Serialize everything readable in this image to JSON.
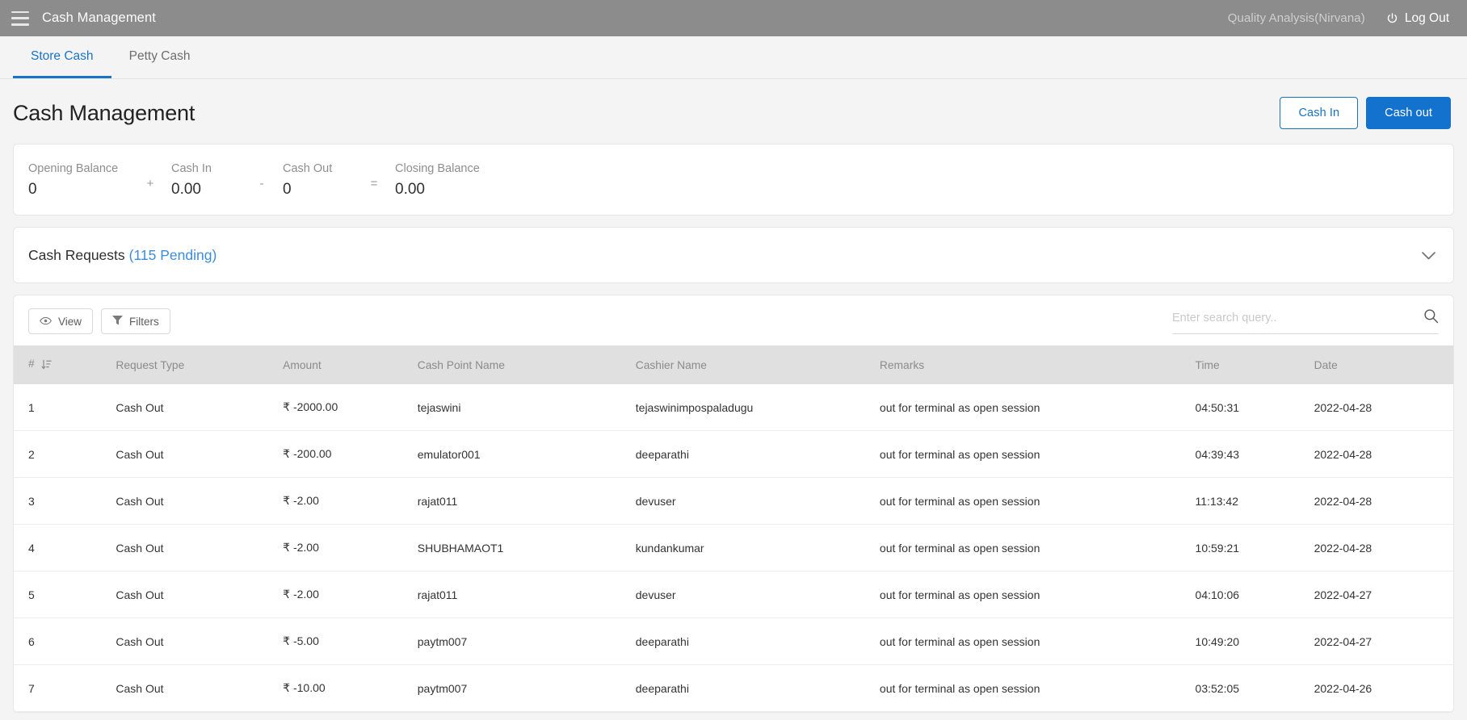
{
  "appbar": {
    "menu_icon": "hamburger-menu-icon",
    "title": "Cash Management",
    "user": "Quality Analysis(Nirvana)",
    "logout_label": "Log Out",
    "logout_icon": "power-icon",
    "background": "#8c8c8c"
  },
  "tabs": [
    {
      "label": "Store Cash",
      "active": true
    },
    {
      "label": "Petty Cash",
      "active": false
    }
  ],
  "page": {
    "title": "Cash Management",
    "accent_color": "#1272ce",
    "cash_in_button": "Cash In",
    "cash_out_button": "Cash out"
  },
  "balance": {
    "opening": {
      "label": "Opening Balance",
      "value": "0"
    },
    "op_plus": "+",
    "cash_in": {
      "label": "Cash In",
      "value": "0.00"
    },
    "op_minus": "-",
    "cash_out": {
      "label": "Cash Out",
      "value": "0"
    },
    "op_equals": "=",
    "closing": {
      "label": "Closing Balance",
      "value": "0.00"
    }
  },
  "requests": {
    "title": "Cash Requests",
    "pending": "(115 Pending)",
    "pending_color": "#3d8ddb",
    "chevron_icon": "chevron-down-icon"
  },
  "toolbar": {
    "view_label": "View",
    "view_icon": "eye-icon",
    "filters_label": "Filters",
    "filters_icon": "funnel-icon",
    "search_placeholder": "Enter search query..",
    "search_value": "",
    "search_icon": "search-icon"
  },
  "table": {
    "columns": [
      "#",
      "Request Type",
      "Amount",
      "Cash Point Name",
      "Cashier Name",
      "Remarks",
      "Time",
      "Date"
    ],
    "sort_icon": "sort-icon",
    "rows": [
      {
        "num": "1",
        "type": "Cash Out",
        "amount": "₹ -2000.00",
        "cash_point": "tejaswini",
        "cashier": "tejaswinimpospaladugu",
        "remarks": "out for terminal as open session",
        "time": "04:50:31",
        "date": "2022-04-28"
      },
      {
        "num": "2",
        "type": "Cash Out",
        "amount": "₹ -200.00",
        "cash_point": "emulator001",
        "cashier": "deeparathi",
        "remarks": "out for terminal as open session",
        "time": "04:39:43",
        "date": "2022-04-28"
      },
      {
        "num": "3",
        "type": "Cash Out",
        "amount": "₹ -2.00",
        "cash_point": "rajat011",
        "cashier": "devuser",
        "remarks": "out for terminal as open session",
        "time": "11:13:42",
        "date": "2022-04-28"
      },
      {
        "num": "4",
        "type": "Cash Out",
        "amount": "₹ -2.00",
        "cash_point": "SHUBHAMAOT1",
        "cashier": "kundankumar",
        "remarks": "out for terminal as open session",
        "time": "10:59:21",
        "date": "2022-04-28"
      },
      {
        "num": "5",
        "type": "Cash Out",
        "amount": "₹ -2.00",
        "cash_point": "rajat011",
        "cashier": "devuser",
        "remarks": "out for terminal as open session",
        "time": "04:10:06",
        "date": "2022-04-27"
      },
      {
        "num": "6",
        "type": "Cash Out",
        "amount": "₹ -5.00",
        "cash_point": "paytm007",
        "cashier": "deeparathi",
        "remarks": "out for terminal as open session",
        "time": "10:49:20",
        "date": "2022-04-27"
      },
      {
        "num": "7",
        "type": "Cash Out",
        "amount": "₹ -10.00",
        "cash_point": "paytm007",
        "cashier": "deeparathi",
        "remarks": "out for terminal as open session",
        "time": "03:52:05",
        "date": "2022-04-26"
      }
    ]
  }
}
